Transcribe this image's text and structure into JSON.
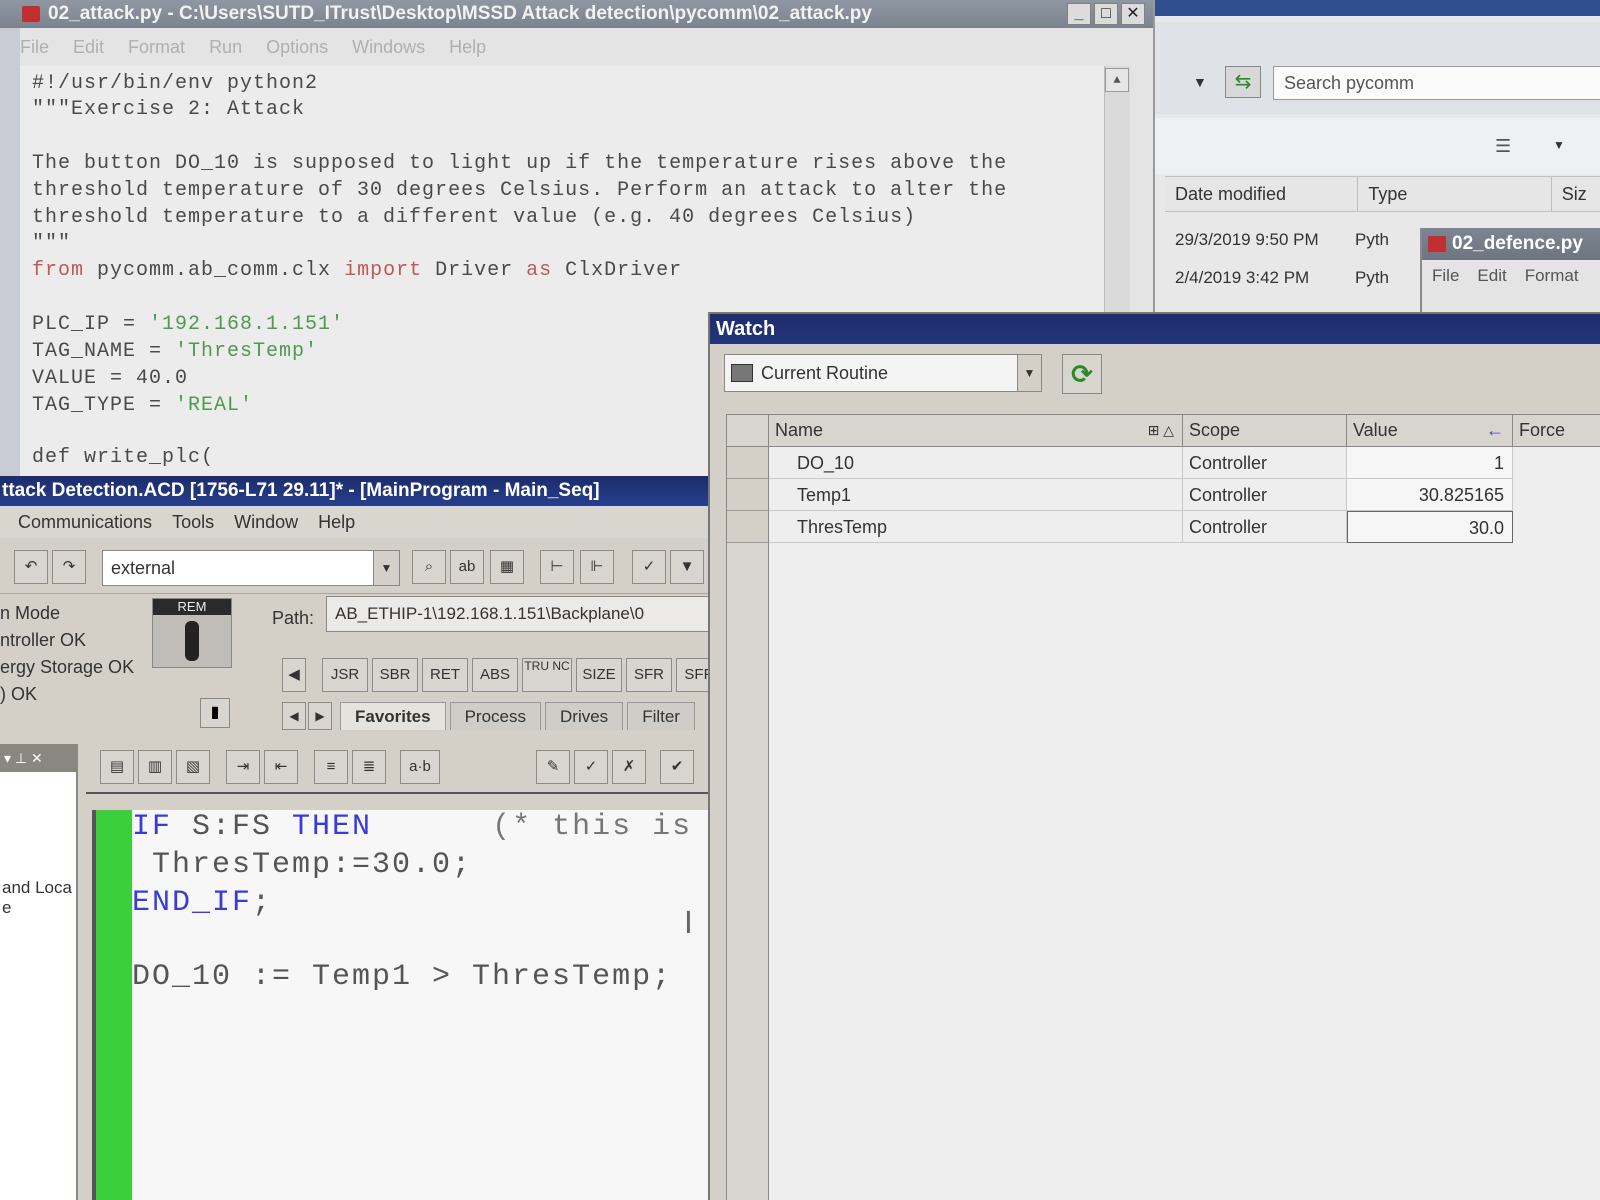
{
  "idle": {
    "title": "02_attack.py - C:\\Users\\SUTD_ITrust\\Desktop\\MSSD Attack detection\\pycomm\\02_attack.py",
    "menu": [
      "File",
      "Edit",
      "Format",
      "Run",
      "Options",
      "Windows",
      "Help"
    ],
    "code": {
      "l1": "#!/usr/bin/env python2",
      "l2": "\"\"\"Exercise 2: Attack",
      "l3": "The button DO_10 is supposed to light up if the temperature rises above the",
      "l4": "threshold temperature of 30 degrees Celsius. Perform an attack to alter the",
      "l5": "threshold temperature to a different value (e.g. 40 degrees Celsius)",
      "l6": "\"\"\"",
      "l7_from": "from",
      "l7_mod": " pycomm.ab_comm.clx ",
      "l7_import": "import",
      "l7_drv": " Driver ",
      "l7_as": "as",
      "l7_alias": " ClxDriver",
      "l8a": "PLC_IP = ",
      "l8b": "'192.168.1.151'",
      "l9a": "TAG_NAME = ",
      "l9b": "'ThresTemp'",
      "l10": "VALUE = 40.0",
      "l11a": "TAG_TYPE = ",
      "l11b": "'REAL'",
      "l12": "def write_plc("
    }
  },
  "explorer": {
    "search_placeholder": "Search pycomm",
    "columns": [
      "Date modified",
      "Type",
      "Siz"
    ],
    "files": [
      {
        "date": "29/3/2019 9:50 PM",
        "type": "Pyth"
      },
      {
        "date": "2/4/2019 3:42 PM",
        "type": "Pyth"
      }
    ]
  },
  "defence": {
    "title": "02_defence.py",
    "menu": [
      "File",
      "Edit",
      "Format"
    ]
  },
  "rslogix": {
    "title": "ttack Detection.ACD [1756-L71 29.11]* - [MainProgram - Main_Seq]",
    "menu": [
      "Communications",
      "Tools",
      "Window",
      "Help"
    ],
    "combo_value": "external",
    "status": [
      "n Mode",
      "ntroller OK",
      "ergy Storage OK",
      ") OK"
    ],
    "keyswitch": "REM",
    "path_label": "Path:",
    "path_value": "AB_ETHIP-1\\192.168.1.151\\Backplane\\0",
    "instructions": [
      "JSR",
      "SBR",
      "RET",
      "ABS",
      "TRU NC",
      "SIZE",
      "SFR",
      "SFP"
    ],
    "tabs": [
      "Favorites",
      "Process",
      "Drives",
      "Filter"
    ],
    "pane_text": "and Loca",
    "pane_text2": "e",
    "st": {
      "if": "IF",
      "cond": " S:FS ",
      "then": "THEN",
      "comment": "      (* this is",
      "assign": " ThresTemp:=30.0;",
      "endif": "END_IF",
      "endsemi": ";",
      "line4": "DO_10 := Temp1 > ThresTemp;"
    }
  },
  "watch": {
    "title": "Watch",
    "scope": "Current Routine",
    "columns": [
      "Name",
      "Scope",
      "Value",
      "Force"
    ],
    "rows": [
      {
        "name": "DO_10",
        "scope": "Controller",
        "value": "1"
      },
      {
        "name": "Temp1",
        "scope": "Controller",
        "value": "30.825165"
      },
      {
        "name": "ThresTemp",
        "scope": "Controller",
        "value": "30.0"
      }
    ]
  }
}
